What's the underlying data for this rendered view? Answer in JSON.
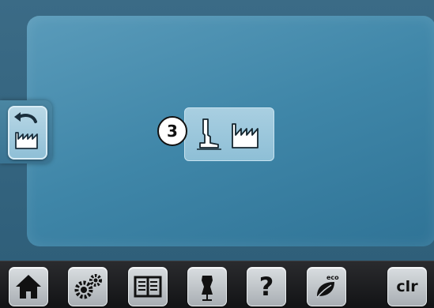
{
  "reset_dialog": {
    "step_number": "3",
    "presser_foot_icon": "presser-foot-icon",
    "factory_icon": "factory-icon"
  },
  "sidebar": {
    "back_icon": "back-arrow-factory-icon"
  },
  "toolbar": {
    "buttons": [
      {
        "name": "home",
        "icon": "home-icon"
      },
      {
        "name": "setup",
        "icon": "gears-icon"
      },
      {
        "name": "tutorial",
        "icon": "book-icon"
      },
      {
        "name": "creative-consultant",
        "icon": "dress-form-icon"
      },
      {
        "name": "help",
        "icon": "question-icon",
        "label": "?"
      },
      {
        "name": "eco",
        "icon": "eco-leaf-icon",
        "label": "eco"
      },
      {
        "name": "clear",
        "icon": "",
        "label": "clr"
      }
    ]
  },
  "colors": {
    "screen_bg": "#2f5f7a",
    "panel_bg": "#3f86a8",
    "toolbar_bg": "#1c1d1f",
    "button_face": "#c8cdd1"
  }
}
